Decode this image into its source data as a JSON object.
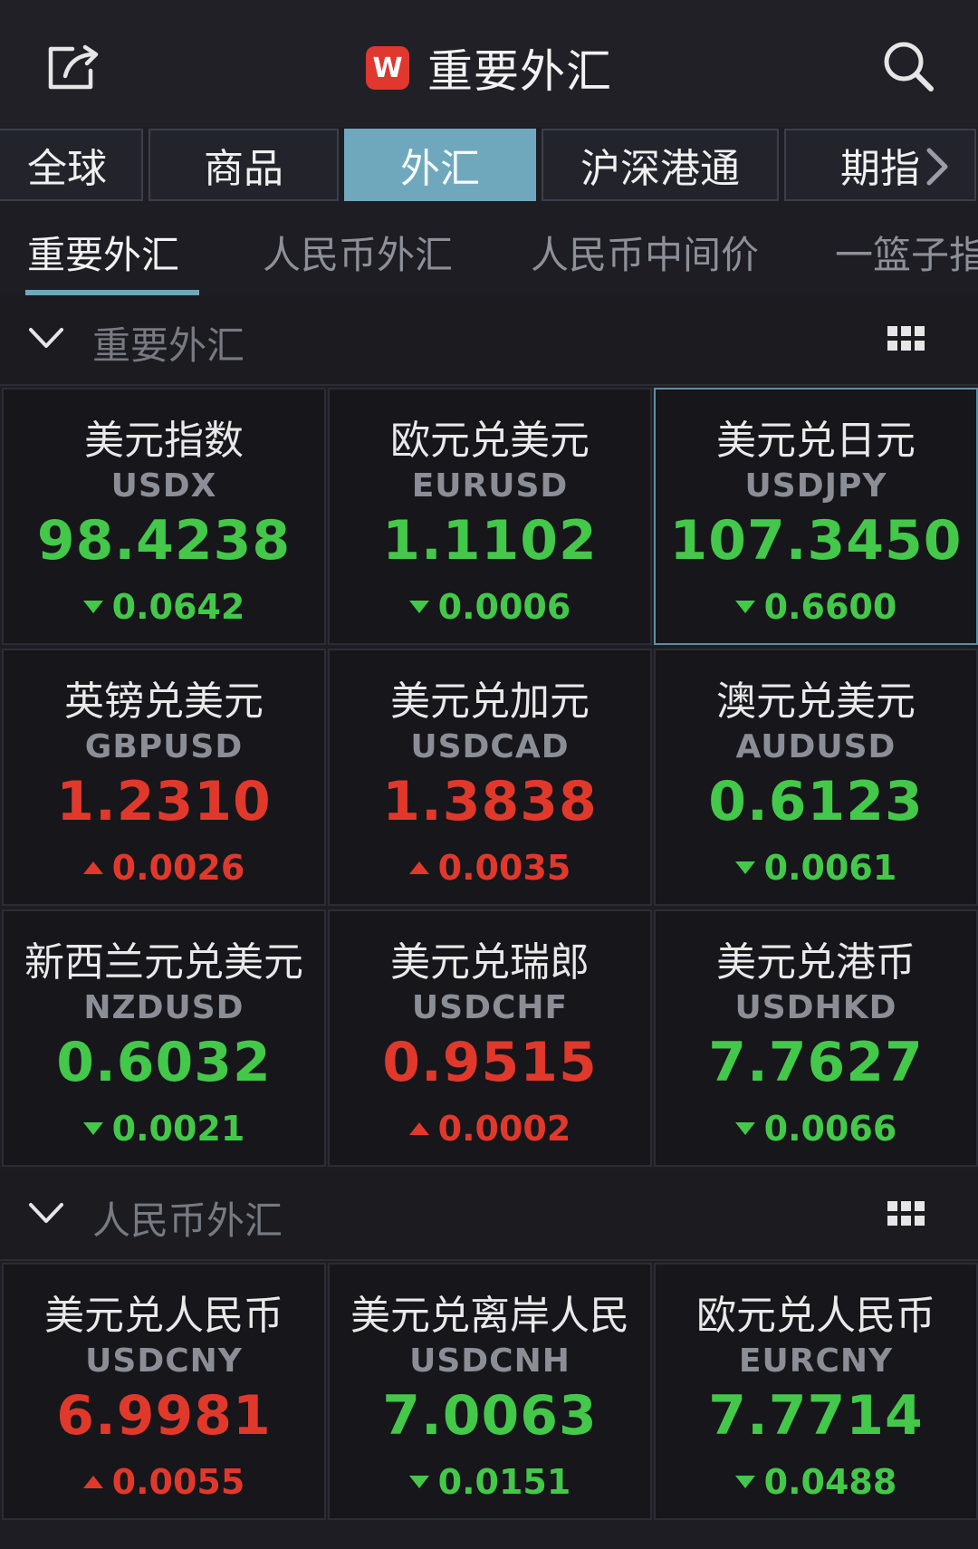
{
  "header": {
    "title": "重要外汇",
    "logo_letter": "W"
  },
  "market_tabs": [
    {
      "label": "全球",
      "active": false
    },
    {
      "label": "商品",
      "active": false
    },
    {
      "label": "外汇",
      "active": true
    },
    {
      "label": "沪深港通",
      "active": false
    },
    {
      "label": "期指",
      "active": false
    }
  ],
  "sub_tabs": [
    {
      "label": "重要外汇",
      "active": true
    },
    {
      "label": "人民币外汇",
      "active": false
    },
    {
      "label": "人民币中间价",
      "active": false
    },
    {
      "label": "一篮子指",
      "active": false
    }
  ],
  "sections": [
    {
      "title": "重要外汇",
      "quotes": [
        {
          "name": "美元指数",
          "code": "USDX",
          "price": "98.4238",
          "change": "0.0642",
          "direction": "down"
        },
        {
          "name": "欧元兑美元",
          "code": "EURUSD",
          "price": "1.1102",
          "change": "0.0006",
          "direction": "down"
        },
        {
          "name": "美元兑日元",
          "code": "USDJPY",
          "price": "107.3450",
          "change": "0.6600",
          "direction": "down",
          "selected": true
        },
        {
          "name": "英镑兑美元",
          "code": "GBPUSD",
          "price": "1.2310",
          "change": "0.0026",
          "direction": "up"
        },
        {
          "name": "美元兑加元",
          "code": "USDCAD",
          "price": "1.3838",
          "change": "0.0035",
          "direction": "up"
        },
        {
          "name": "澳元兑美元",
          "code": "AUDUSD",
          "price": "0.6123",
          "change": "0.0061",
          "direction": "down"
        },
        {
          "name": "新西兰元兑美元",
          "code": "NZDUSD",
          "price": "0.6032",
          "change": "0.0021",
          "direction": "down"
        },
        {
          "name": "美元兑瑞郎",
          "code": "USDCHF",
          "price": "0.9515",
          "change": "0.0002",
          "direction": "up"
        },
        {
          "name": "美元兑港币",
          "code": "USDHKD",
          "price": "7.7627",
          "change": "0.0066",
          "direction": "down"
        }
      ]
    },
    {
      "title": "人民币外汇",
      "quotes": [
        {
          "name": "美元兑人民币",
          "code": "USDCNY",
          "price": "6.9981",
          "change": "0.0055",
          "direction": "up"
        },
        {
          "name": "美元兑离岸人民",
          "code": "USDCNH",
          "price": "7.0063",
          "change": "0.0151",
          "direction": "down"
        },
        {
          "name": "欧元兑人民币",
          "code": "EURCNY",
          "price": "7.7714",
          "change": "0.0488",
          "direction": "down"
        }
      ]
    }
  ],
  "colors": {
    "up": "#e0392b",
    "down": "#43c84a",
    "accent": "#6fa8bd",
    "logo": "#e0372f"
  },
  "icons": [
    "share-icon",
    "search-icon",
    "chevron-right-icon",
    "chevron-down-icon",
    "grid-menu-icon",
    "triangle-up-icon",
    "triangle-down-icon"
  ]
}
